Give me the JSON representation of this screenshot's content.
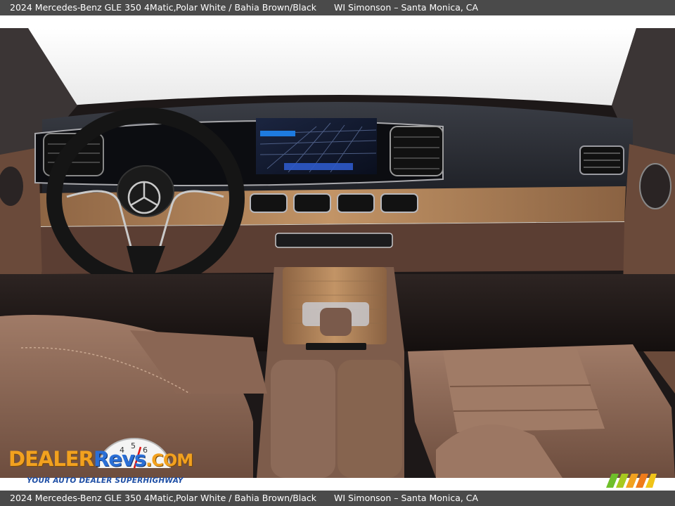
{
  "caption": {
    "vehicle": "2024 Mercedes-Benz GLE 350 4Matic,",
    "color": "Polar White / Bahia Brown/Black",
    "dealer": "WI Simonson – Santa Monica, CA"
  },
  "watermark": {
    "brand_part1": "DEALER",
    "brand_part2": "Revs",
    "brand_tld": ".COM",
    "tagline": "YOUR AUTO DEALER SUPERHIGHWAY",
    "gauge_numbers": [
      "4",
      "5",
      "6"
    ]
  },
  "photo": {
    "subject": "vehicle-interior",
    "colors": {
      "leather": "#7b5a4a",
      "leather_light": "#9a7561",
      "wood": "#b5855a",
      "dash_dark": "#2a2c33",
      "windshield": "#f3f3f3"
    }
  }
}
